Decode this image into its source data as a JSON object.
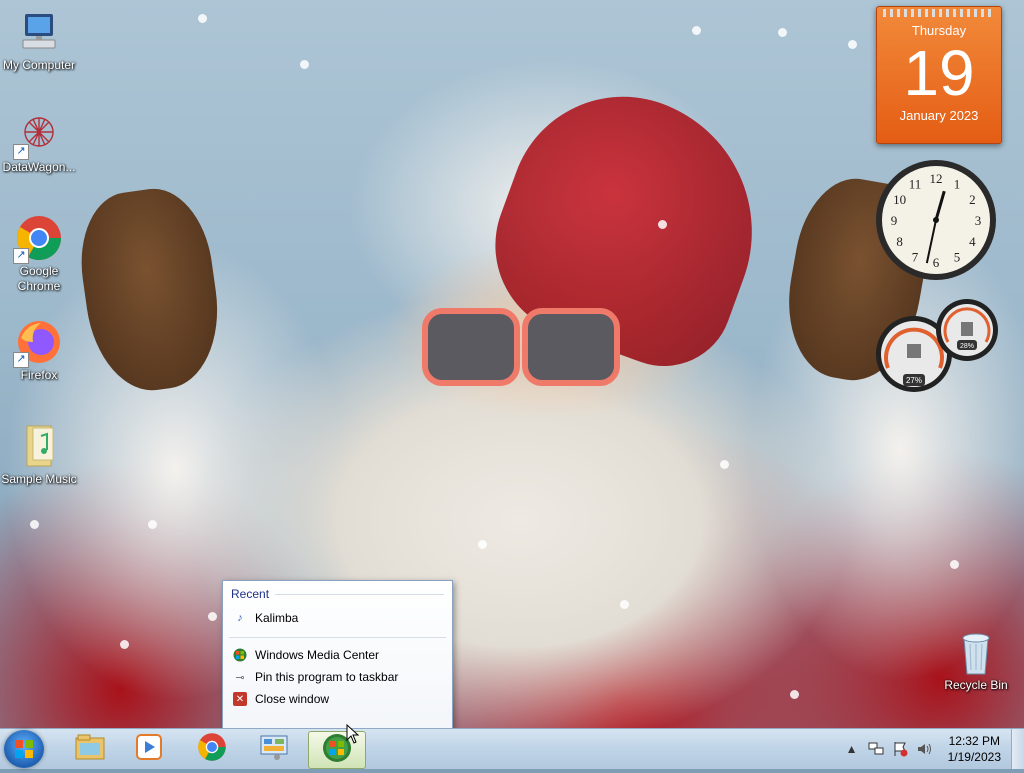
{
  "desktop": {
    "icons": [
      {
        "label": "My Computer",
        "icon": "computer-icon"
      },
      {
        "label": "DataWagon...",
        "icon": "datawagon-icon"
      },
      {
        "label": "Google Chrome",
        "icon": "chrome-icon"
      },
      {
        "label": "Firefox",
        "icon": "firefox-icon"
      },
      {
        "label": "Sample Music",
        "icon": "music-folder-icon"
      }
    ],
    "recycle_bin": {
      "label": "Recycle Bin",
      "icon": "recycle-bin-icon"
    }
  },
  "gadgets": {
    "calendar": {
      "weekday": "Thursday",
      "day": "19",
      "month_year": "January 2023",
      "color": "#e86a1f"
    },
    "clock": {
      "hour": 12,
      "minute": 32,
      "numbers": [
        "12",
        "1",
        "2",
        "3",
        "4",
        "5",
        "6",
        "7",
        "8",
        "9",
        "10",
        "11"
      ]
    },
    "cpu_meter": {
      "cpu_percent": "27%",
      "memory_percent": "28%"
    }
  },
  "jumplist": {
    "recent_header": "Recent",
    "recent_items": [
      {
        "label": "Kalimba",
        "icon": "music-note-icon"
      }
    ],
    "tasks": [
      {
        "label": "Windows Media Center",
        "icon": "media-center-icon"
      },
      {
        "label": "Pin this program to taskbar",
        "icon": "pin-icon"
      },
      {
        "label": "Close window",
        "icon": "close-icon"
      }
    ]
  },
  "taskbar": {
    "start": {
      "icon": "windows-start-icon"
    },
    "pinned": [
      {
        "icon": "explorer-icon"
      },
      {
        "icon": "media-player-icon"
      },
      {
        "icon": "chrome-icon"
      },
      {
        "icon": "control-panel-icon"
      },
      {
        "icon": "media-center-icon",
        "active": true
      }
    ],
    "tray": {
      "icons": [
        "show-hidden-icons-icon",
        "network-icon",
        "action-center-icon",
        "volume-icon"
      ],
      "time": "12:32 PM",
      "date": "1/19/2023"
    },
    "accent": "#c1d5e8"
  }
}
